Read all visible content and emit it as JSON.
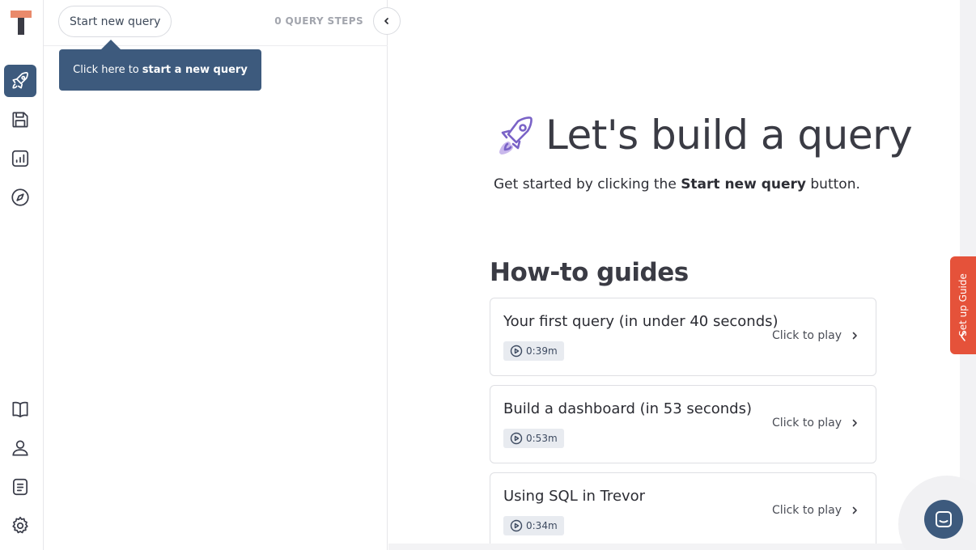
{
  "panel": {
    "start_button": "Start new query",
    "steps_label": "0 QUERY STEPS",
    "tooltip_prefix": "Click here to",
    "tooltip_bold": "start a new query"
  },
  "main": {
    "heading": "Let's build a query",
    "subtitle_prefix": "Get started by clicking the",
    "subtitle_bold": "Start new query",
    "subtitle_suffix": "button.",
    "guides_title": "How-to guides",
    "guides": [
      {
        "title": "Your first query (in under 40 seconds)",
        "duration": "0:39m",
        "action": "Click to play"
      },
      {
        "title": "Build a dashboard (in 53 seconds)",
        "duration": "0:53m",
        "action": "Click to play"
      },
      {
        "title": "Using SQL in Trevor",
        "duration": "0:34m",
        "action": "Click to play"
      }
    ]
  },
  "setup_guide": {
    "label": "Set up Guide"
  },
  "icons": {
    "rail_top": [
      "rocket-icon",
      "save-icon",
      "dashboard-icon",
      "compass-icon"
    ],
    "rail_bottom": [
      "book-icon",
      "user-icon",
      "notes-icon",
      "gear-icon"
    ],
    "chat": "chat-icon"
  },
  "colors": {
    "accent": "#3d5a7d",
    "guide_tab": "#e5523a",
    "logo_top": "#e98a6b",
    "logo_stem": "#3a3b44"
  }
}
